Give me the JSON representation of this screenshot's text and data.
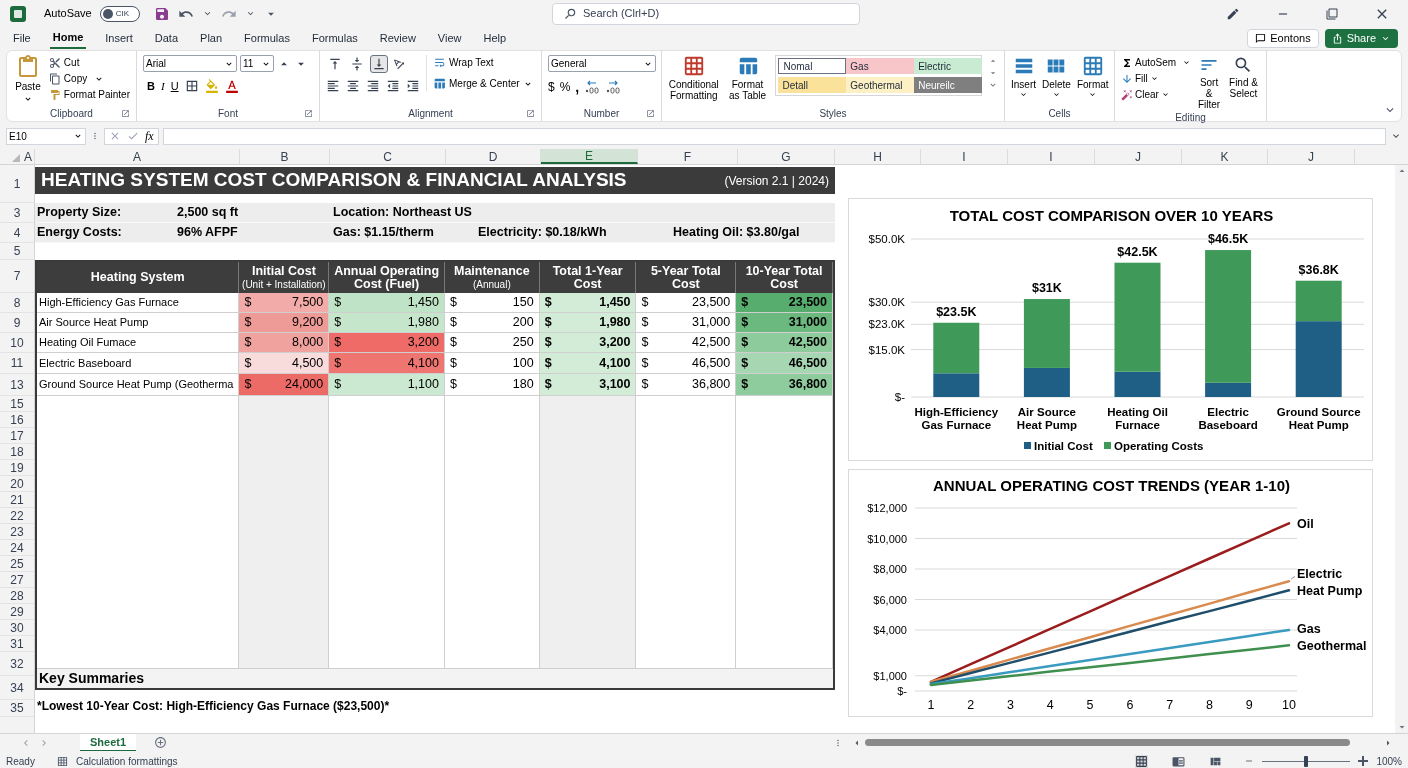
{
  "title_bar": {
    "autosave_label": "AutoSave",
    "autosave_toggle": {
      "text": "CIK",
      "on": false
    },
    "search_placeholder": "Search (Clrl+D)"
  },
  "menu": {
    "tabs": [
      {
        "label": "File",
        "selected": false
      },
      {
        "label": "Home",
        "selected": true
      },
      {
        "label": "Insert",
        "selected": false
      },
      {
        "label": "Data",
        "selected": false
      },
      {
        "label": "Plan",
        "selected": false
      },
      {
        "label": "Formulas",
        "selected": false
      },
      {
        "label": "Formulas",
        "selected": false
      },
      {
        "label": "Review",
        "selected": false
      },
      {
        "label": "View",
        "selected": false
      },
      {
        "label": "Help",
        "selected": false
      }
    ],
    "comments_button": "Eontons",
    "share_button": "Share"
  },
  "ribbon": {
    "clipboard": {
      "label": "Clipboard",
      "paste": "Paste",
      "cut": "Cut",
      "copy": "Copy",
      "format_painter": "Format Painter"
    },
    "font": {
      "label": "Font",
      "family": "Arial",
      "size": "11",
      "bold": "B",
      "italic": "I",
      "underline": "U"
    },
    "alignment": {
      "label": "Alignment",
      "vertical": [
        {
          "selected": false
        },
        {
          "selected": false
        },
        {
          "selected": true
        }
      ],
      "wrap_text": "Wrap Text",
      "merge_center": "Merge & Center"
    },
    "number": {
      "label": "Number",
      "format": "General",
      "currency": "$",
      "percent": "%",
      "comma": ","
    },
    "styles": {
      "label": "Styles",
      "conditional_formatting": "Conditional Formatting",
      "format_as_table": "Format as Table",
      "cell_styles": [
        {
          "name": "Nomal",
          "color": "#ffffff"
        },
        {
          "name": "Gas",
          "color": "#f8c6c8"
        },
        {
          "name": "Electric",
          "color": "#c9ebd1"
        },
        {
          "name": "Detall",
          "color": "#fbe29a"
        },
        {
          "name": "Geothermal",
          "color": "#fdf0c4"
        },
        {
          "name": "Neureilc",
          "color": "#7f7f7f"
        }
      ]
    },
    "cells": {
      "label": "Cells",
      "insert": "Insert",
      "delete": "Delete",
      "format": "Format"
    },
    "editing": {
      "label": "Editing",
      "autosum": "AutoSem",
      "fill": "Fill",
      "clear": "Clear",
      "sort_filter": "Sort & Filter",
      "find_select": "Find & Select"
    }
  },
  "formula_bar": {
    "name_box": "E10",
    "fx": "fx"
  },
  "sheet": {
    "column_headers": [
      {
        "label": "A",
        "selected": false
      },
      {
        "label": "A",
        "selected": false
      },
      {
        "label": "B",
        "selected": false
      },
      {
        "label": "C",
        "selected": false
      },
      {
        "label": "D",
        "selected": false
      },
      {
        "label": "E",
        "selected": true
      },
      {
        "label": "F",
        "selected": false
      },
      {
        "label": "G",
        "selected": false
      },
      {
        "label": "H",
        "selected": false
      },
      {
        "label": "I",
        "selected": false
      },
      {
        "label": "I",
        "selected": false
      },
      {
        "label": "J",
        "selected": false
      },
      {
        "label": "K",
        "selected": false
      },
      {
        "label": "J",
        "selected": false
      }
    ],
    "row_numbers": [
      "1",
      "3",
      "4",
      "5",
      "7",
      "8",
      "9",
      "10",
      "11",
      "13",
      "15",
      "16",
      "17",
      "18",
      "19",
      "20",
      "21",
      "22",
      "23",
      "24",
      "25",
      "27",
      "28",
      "29",
      "30",
      "31",
      "32",
      "34",
      "35"
    ],
    "title": "HEATING SYSTEM COST COMPARISON & FINANCIAL ANALYSIS",
    "version": "(Version 2.1 | 2024)",
    "info": [
      {
        "label": "Property Size:",
        "value": "2,500 sq ft",
        "items": [
          "Location: Northeast US"
        ]
      },
      {
        "label": "Energy Costs:",
        "value": "96% AFPF",
        "items": [
          "Gas: $1.15/therm",
          "Electricity: $0.18/kWh",
          "Heating Oil: $3.80/gal"
        ]
      }
    ],
    "table": {
      "columns": [
        {
          "label": "Heating System",
          "bold": false
        },
        {
          "label": "Initial Cost",
          "sublabel": "(Unit + Installation)",
          "bold": false
        },
        {
          "label": "Annual Operating Cost (Fuel)",
          "bold": false
        },
        {
          "label": "Maintenance",
          "sublabel": "(Annual)",
          "bold": false
        },
        {
          "label": "Total 1-Year Cost",
          "bold": true
        },
        {
          "label": "5-Year Total Cost",
          "bold": false
        },
        {
          "label": "10-Year Total Cost",
          "bold": true
        }
      ],
      "rows": [
        {
          "cells": [
            {
              "value": "High-Efficiency Gas Furnace"
            },
            {
              "symbol": "$",
              "value": "7,500",
              "color": "#f2aba8"
            },
            {
              "symbol": "$",
              "value": "1,450",
              "color": "#bfe3c6"
            },
            {
              "symbol": "$",
              "value": "150",
              "color": "#ffffff"
            },
            {
              "symbol": "$",
              "value": "1,450",
              "color": "#d3ecd8"
            },
            {
              "symbol": "$",
              "value": "23,500",
              "color": "#ffffff"
            },
            {
              "symbol": "$",
              "value": "23,500",
              "color": "#56ad6e"
            }
          ]
        },
        {
          "cells": [
            {
              "value": "Air Source Heat Pump"
            },
            {
              "symbol": "$",
              "value": "9,200",
              "color": "#ee9a97"
            },
            {
              "symbol": "$",
              "value": "1,980",
              "color": "#c6e6cc"
            },
            {
              "symbol": "$",
              "value": "200",
              "color": "#ffffff"
            },
            {
              "symbol": "$",
              "value": "1,980",
              "color": "#d3ecd8"
            },
            {
              "symbol": "$",
              "value": "31,000",
              "color": "#ffffff"
            },
            {
              "symbol": "$",
              "value": "31,000",
              "color": "#6cb980"
            }
          ]
        },
        {
          "cells": [
            {
              "value": "Heating Oil Fumace"
            },
            {
              "symbol": "$",
              "value": "8,000",
              "color": "#f0a29f"
            },
            {
              "symbol": "$",
              "value": "3,200",
              "color": "#ee6b67"
            },
            {
              "symbol": "$",
              "value": "250",
              "color": "#ffffff"
            },
            {
              "symbol": "$",
              "value": "3,200",
              "color": "#d3ecd8"
            },
            {
              "symbol": "$",
              "value": "42,500",
              "color": "#ffffff"
            },
            {
              "symbol": "$",
              "value": "42,500",
              "color": "#8dcb9c"
            }
          ]
        },
        {
          "cells": [
            {
              "value": "Electric Baseboard"
            },
            {
              "symbol": "$",
              "value": "4,500",
              "color": "#f8dcdb"
            },
            {
              "symbol": "$",
              "value": "4,100",
              "color": "#ef7571"
            },
            {
              "symbol": "$",
              "value": "100",
              "color": "#ffffff"
            },
            {
              "symbol": "$",
              "value": "4,100",
              "color": "#d3ecd8"
            },
            {
              "symbol": "$",
              "value": "46,500",
              "color": "#ffffff"
            },
            {
              "symbol": "$",
              "value": "46,500",
              "color": "#a7d7b2"
            }
          ]
        },
        {
          "cells": [
            {
              "value": "Ground Source Heat Pump (Geotherma"
            },
            {
              "symbol": "$",
              "value": "24,000",
              "color": "#ec6b67"
            },
            {
              "symbol": "$",
              "value": "1,100",
              "color": "#cbe8d0"
            },
            {
              "symbol": "$",
              "value": "180",
              "color": "#ffffff"
            },
            {
              "symbol": "$",
              "value": "3,100",
              "color": "#d3ecd8"
            },
            {
              "symbol": "$",
              "value": "36,800",
              "color": "#ffffff"
            },
            {
              "symbol": "$",
              "value": "36,800",
              "color": "#8fcc9d"
            }
          ]
        }
      ]
    },
    "summary_heading": "Key Summaries",
    "note": "*Lowest 10-Year Cost: High-Efficiency Gas Furnace ($23,500)*"
  },
  "charts": [
    {
      "chart_data": {
        "type": "bar",
        "title": "TOTAL COST COMPARISON OVER 10 YEARS",
        "categories": [
          "High-Efficiency Gas Furnace",
          "Air Source Heat Pump",
          "Heating Oil Furnace",
          "Electric Baseboard",
          "Ground Source Heat Pump"
        ],
        "series": [
          {
            "name": "Initial Cost",
            "color": "#1f5f86",
            "values": [
              7500,
              9200,
              8000,
              4500,
              24000
            ]
          },
          {
            "name": "Operating Costs",
            "color": "#3f9a5a",
            "values": [
              16000,
              21800,
              34500,
              42000,
              12800
            ]
          }
        ],
        "grid": true,
        "legend": "bottom",
        "ylim": [
          0,
          50000
        ],
        "yticks": [
          {
            "value": 0,
            "label": "$-"
          },
          {
            "value": 15000,
            "label": "$15.0K"
          },
          {
            "value": 23000,
            "label": "$23.0K"
          },
          {
            "value": 30000,
            "label": "$30.0K"
          },
          {
            "value": 50000,
            "label": "$50.0K"
          }
        ],
        "stacked": true,
        "value_labels": [
          "$23.5K",
          "$31K",
          "$42.5K",
          "$46.5K",
          "$36.8K"
        ]
      }
    },
    {
      "chart_data": {
        "type": "line",
        "title": "ANNUAL OPERATING COST TRENDS (YEAR 1-10)",
        "x": [
          1,
          2,
          3,
          4,
          5,
          6,
          7,
          8,
          9,
          10
        ],
        "series": [
          {
            "name": "Oil",
            "color": "#9b1c1c",
            "values": [
              600,
              1760,
              2910,
              4070,
              5220,
              6380,
              7530,
              8690,
              9840,
              11000
            ]
          },
          {
            "name": "Electric",
            "color": "#d98a4e",
            "values": [
              600,
              1330,
              2070,
              2800,
              3530,
              4270,
              5000,
              5730,
              6470,
              7200
            ]
          },
          {
            "name": "Heat Pump",
            "color": "#1f4e6b",
            "values": [
              500,
              1180,
              1860,
              2530,
              3210,
              3890,
              4570,
              5240,
              5920,
              6600
            ]
          },
          {
            "name": "Gas",
            "color": "#3a9bc1",
            "values": [
              450,
              840,
              1240,
              1630,
              2030,
              2420,
              2820,
              3210,
              3610,
              4000
            ]
          },
          {
            "name": "Geothermal",
            "color": "#3f8f4f",
            "values": [
              400,
              690,
              980,
              1270,
              1560,
              1840,
              2130,
              2420,
              2710,
              3000
            ]
          }
        ],
        "grid": true,
        "xlim": [
          0.6,
          10.2
        ],
        "xticks": [
          1,
          2,
          3,
          4,
          5,
          6,
          7,
          8,
          9,
          10
        ],
        "ylim": [
          0,
          12000
        ],
        "yticks": [
          {
            "value": 0,
            "label": "$-"
          },
          {
            "value": 1000,
            "label": "$1,000"
          },
          {
            "value": 4000,
            "label": "$4,000"
          },
          {
            "value": 6000,
            "label": "$6,000"
          },
          {
            "value": 8000,
            "label": "$8,000"
          },
          {
            "value": 10000,
            "label": "$10,000"
          },
          {
            "value": 12000,
            "label": "$12,000"
          }
        ]
      }
    }
  ],
  "sheet_tabs": [
    {
      "label": "Sheet1",
      "selected": true
    }
  ],
  "status_bar": {
    "ready": "Ready",
    "message": "Calculation formattings",
    "zoom": {
      "level": 0.5
    },
    "zoom_label": "100%"
  }
}
